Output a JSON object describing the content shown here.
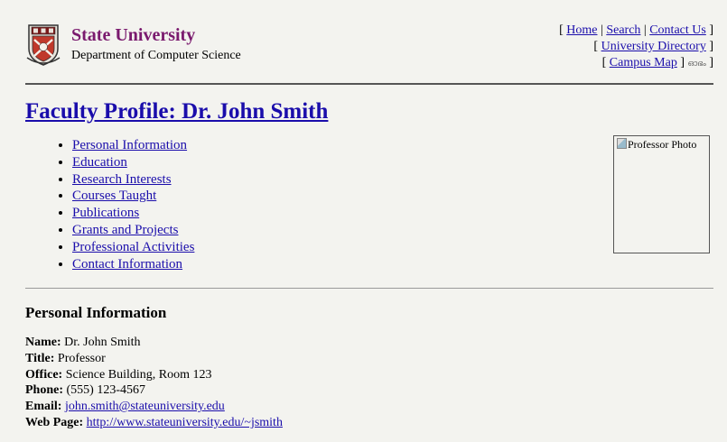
{
  "header": {
    "university_name": "State University",
    "department_name": "Department of Computer Science",
    "seal_icon": "university-seal-icon",
    "nav_links": {
      "home": "Home",
      "search": "Search",
      "contact_us": "Contact Us",
      "university_directory": "University Directory",
      "campus_map": "Campus Map",
      "campus_map_suffix_glyph": "ഓഭം"
    },
    "bracket_open": "[",
    "bracket_close": "]",
    "separator": "|",
    "name_color": "#7a1a6e"
  },
  "page": {
    "title": "Faculty Profile: Dr. John Smith"
  },
  "toc": [
    "Personal Information",
    "Education",
    "Research Interests",
    "Courses Taught",
    "Publications",
    "Grants and Projects",
    "Professional Activities",
    "Contact Information"
  ],
  "photo": {
    "alt_text": "Professor Photo",
    "icon": "broken-image-icon"
  },
  "personal_info": {
    "heading": "Personal Information",
    "name_label": "Name:",
    "name_value": "Dr. John Smith",
    "title_label": "Title:",
    "title_value": "Professor",
    "office_label": "Office:",
    "office_value": "Science Building, Room 123",
    "phone_label": "Phone:",
    "phone_value": "(555) 123-4567",
    "email_label": "Email:",
    "email_value": "john.smith@stateuniversity.edu",
    "webpage_label": "Web Page:",
    "webpage_value": "http://www.stateuniversity.edu/~jsmith"
  },
  "colors": {
    "link": "#1a0dab",
    "background": "#f3f3ef"
  }
}
